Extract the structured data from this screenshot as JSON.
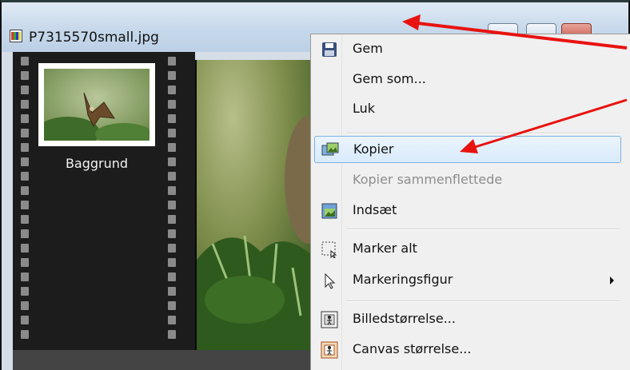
{
  "window": {
    "title": "P7315570small.jpg",
    "icons": {
      "app": "image-file-icon",
      "minimize": "minimize-icon",
      "maximize": "maximize-icon",
      "close": "close-icon"
    }
  },
  "filmstrip": {
    "layer_label": "Baggrund"
  },
  "context_menu": {
    "items": [
      {
        "label": "Gem",
        "icon": "save-disk-icon",
        "disabled": false
      },
      {
        "label": "Gem som...",
        "icon": "",
        "disabled": false
      },
      {
        "label": "Luk",
        "icon": "",
        "disabled": false
      },
      {
        "label": "Kopier",
        "icon": "copy-image-icon",
        "disabled": false,
        "highlighted": true
      },
      {
        "label": "Kopier sammenflettede",
        "icon": "",
        "disabled": true
      },
      {
        "label": "Indsæt",
        "icon": "paste-image-icon",
        "disabled": false
      },
      {
        "label": "Marker alt",
        "icon": "select-all-icon",
        "disabled": false
      },
      {
        "label": "Markeringsfigur",
        "icon": "cursor-arrow-icon",
        "disabled": false,
        "submenu": true
      },
      {
        "label": "Billedstørrelse...",
        "icon": "image-size-icon",
        "disabled": false
      },
      {
        "label": "Canvas størrelse...",
        "icon": "canvas-size-icon",
        "disabled": false
      }
    ]
  },
  "annotation_color": "#e8130f",
  "highlight_color": "#7fb1e0"
}
